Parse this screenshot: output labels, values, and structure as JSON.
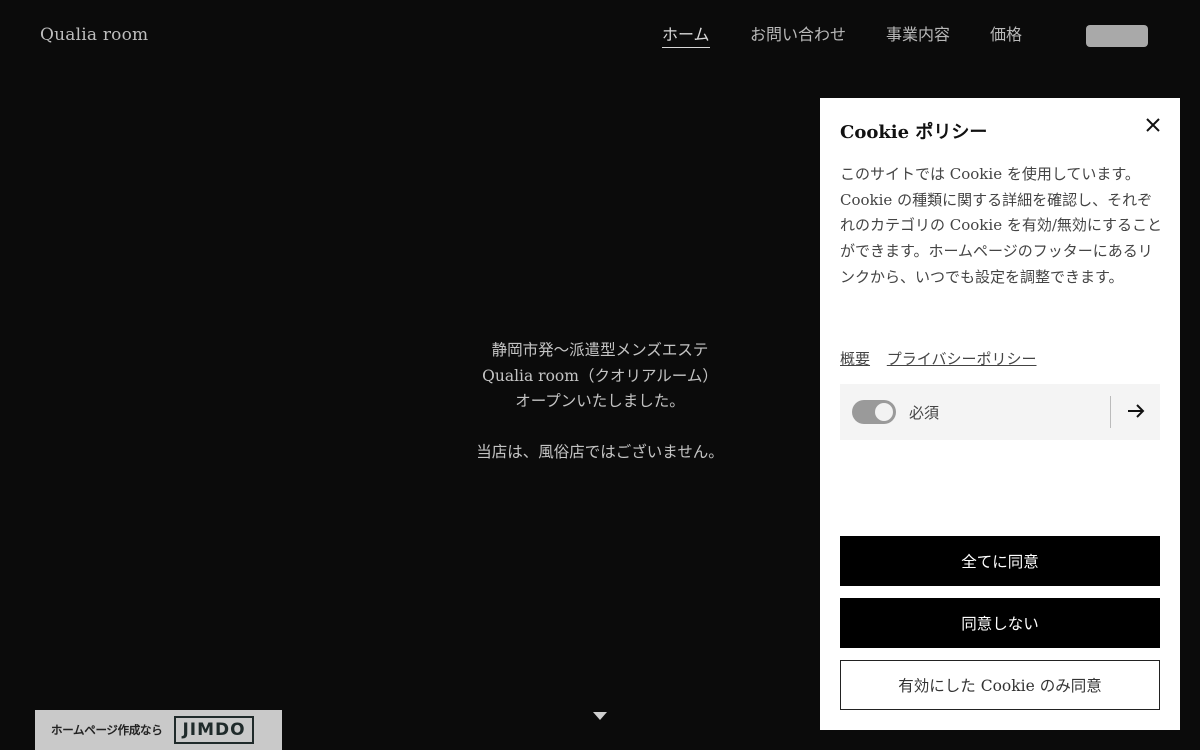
{
  "site": {
    "title": "Qualia room"
  },
  "nav": {
    "items": [
      {
        "label": "ホーム",
        "active": true
      },
      {
        "label": "お問い合わせ",
        "active": false
      },
      {
        "label": "事業内容",
        "active": false
      },
      {
        "label": "価格",
        "active": false
      }
    ]
  },
  "hero": {
    "line1": "静岡市発〜派遣型メンズエステ",
    "line2": "Qualia room（クオリアルーム）",
    "line3": "オープンいたしました。",
    "line4": "当店は、風俗店ではございません。"
  },
  "jimdo": {
    "text": "ホームページ作成なら",
    "logo": "JIMDO"
  },
  "cookie": {
    "title": "Cookie ポリシー",
    "body": "このサイトでは Cookie を使用しています。Cookie の種類に関する詳細を確認し、それぞれのカテゴリの Cookie を有効/無効にすることができます。ホームページのフッターにあるリンクから、いつでも設定を調整できます。",
    "links": {
      "overview": "概要",
      "privacy": "プライバシーポリシー"
    },
    "category": {
      "label": "必須",
      "enabled": true
    },
    "buttons": {
      "accept_all": "全てに同意",
      "decline": "同意しない",
      "accept_selected": "有効にした Cookie のみ同意"
    }
  },
  "colors": {
    "background": "#0b0b0b",
    "panel": "#ffffff",
    "button_dark": "#000000"
  }
}
